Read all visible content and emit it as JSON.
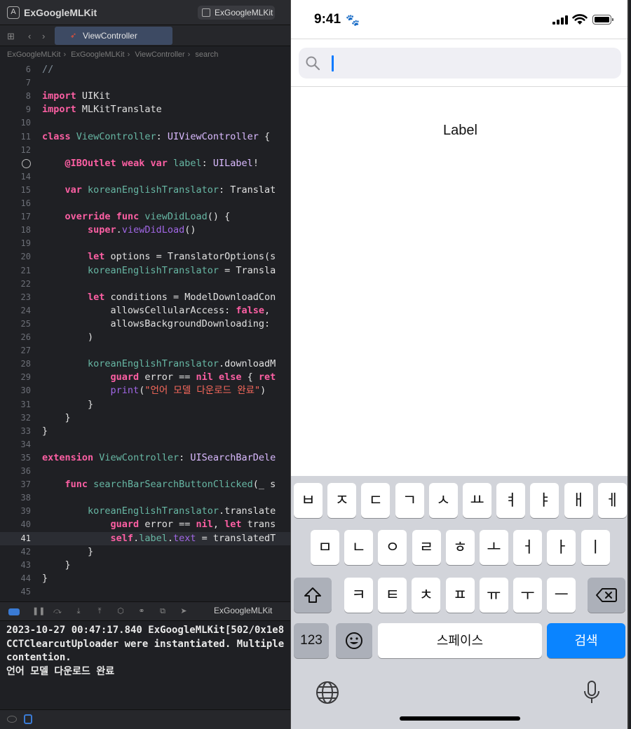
{
  "xcode": {
    "project_title": "ExGoogleMLKit",
    "scheme": "ExGoogleMLKit",
    "active_tab": "ViewController",
    "breadcrumb": [
      "ExGoogleMLKit",
      "ExGoogleMLKit",
      "ViewController",
      "search"
    ],
    "debug_scheme": "ExGoogleMLKit",
    "console_lines": [
      "2023-10-27 00:47:17.840 ExGoogleMLKit[502/0x1e8",
      "CCTClearcutUploader were instantiated. Multiple",
      "contention.",
      "언어 모델 다운로드 완료"
    ]
  },
  "code_lines": [
    {
      "n": "6",
      "tokens": [
        [
          "c",
          "//"
        ]
      ]
    },
    {
      "n": "7",
      "tokens": []
    },
    {
      "n": "8",
      "tokens": [
        [
          "k",
          "import"
        ],
        [
          "",
          " UIKit"
        ]
      ]
    },
    {
      "n": "9",
      "tokens": [
        [
          "k",
          "import"
        ],
        [
          "",
          " MLKitTranslate"
        ]
      ]
    },
    {
      "n": "10",
      "tokens": []
    },
    {
      "n": "11",
      "tokens": [
        [
          "k",
          "class"
        ],
        [
          "",
          " "
        ],
        [
          "p",
          "ViewController"
        ],
        [
          "",
          ": "
        ],
        [
          "ty",
          "UIViewController"
        ],
        [
          "",
          " {"
        ]
      ]
    },
    {
      "n": "12",
      "tokens": []
    },
    {
      "n": "",
      "breakpoint": true,
      "tokens": [
        [
          "",
          "    "
        ],
        [
          "k",
          "@IBOutlet"
        ],
        [
          "",
          " "
        ],
        [
          "k",
          "weak"
        ],
        [
          "",
          " "
        ],
        [
          "k",
          "var"
        ],
        [
          "",
          " "
        ],
        [
          "p",
          "label"
        ],
        [
          "",
          ": "
        ],
        [
          "ty",
          "UILabel"
        ],
        [
          "",
          "!"
        ]
      ]
    },
    {
      "n": "14",
      "tokens": []
    },
    {
      "n": "15",
      "tokens": [
        [
          "",
          "    "
        ],
        [
          "k",
          "var"
        ],
        [
          "",
          " "
        ],
        [
          "p",
          "koreanEnglishTranslator"
        ],
        [
          "",
          ": Translat"
        ]
      ]
    },
    {
      "n": "16",
      "tokens": []
    },
    {
      "n": "17",
      "tokens": [
        [
          "",
          "    "
        ],
        [
          "k",
          "override"
        ],
        [
          "",
          " "
        ],
        [
          "k",
          "func"
        ],
        [
          "",
          " "
        ],
        [
          "p",
          "viewDidLoad"
        ],
        [
          "",
          "() {"
        ]
      ]
    },
    {
      "n": "18",
      "tokens": [
        [
          "",
          "        "
        ],
        [
          "k",
          "super"
        ],
        [
          "",
          "."
        ],
        [
          "m",
          "viewDidLoad"
        ],
        [
          "",
          "()"
        ]
      ]
    },
    {
      "n": "19",
      "tokens": []
    },
    {
      "n": "20",
      "tokens": [
        [
          "",
          "        "
        ],
        [
          "k",
          "let"
        ],
        [
          "",
          " options = TranslatorOptions(s"
        ]
      ]
    },
    {
      "n": "21",
      "tokens": [
        [
          "",
          "        "
        ],
        [
          "p",
          "koreanEnglishTranslator"
        ],
        [
          "",
          " = Transla"
        ]
      ]
    },
    {
      "n": "22",
      "tokens": []
    },
    {
      "n": "23",
      "tokens": [
        [
          "",
          "        "
        ],
        [
          "k",
          "let"
        ],
        [
          "",
          " conditions = ModelDownloadCon"
        ]
      ]
    },
    {
      "n": "24",
      "tokens": [
        [
          "",
          "            allowsCellularAccess: "
        ],
        [
          "k",
          "false"
        ],
        [
          "",
          ","
        ]
      ]
    },
    {
      "n": "25",
      "tokens": [
        [
          "",
          "            allowsBackgroundDownloading:"
        ]
      ]
    },
    {
      "n": "26",
      "tokens": [
        [
          "",
          "        )"
        ]
      ]
    },
    {
      "n": "27",
      "tokens": []
    },
    {
      "n": "28",
      "tokens": [
        [
          "",
          "        "
        ],
        [
          "p",
          "koreanEnglishTranslator"
        ],
        [
          "",
          ".downloadM"
        ]
      ]
    },
    {
      "n": "29",
      "tokens": [
        [
          "",
          "            "
        ],
        [
          "k",
          "guard"
        ],
        [
          "",
          " error == "
        ],
        [
          "k",
          "nil"
        ],
        [
          "",
          " "
        ],
        [
          "k",
          "else"
        ],
        [
          "",
          " { "
        ],
        [
          "k",
          "ret"
        ]
      ]
    },
    {
      "n": "30",
      "tokens": [
        [
          "",
          "            "
        ],
        [
          "m",
          "print"
        ],
        [
          "",
          "("
        ],
        [
          "s",
          "\"언어 모델 다운로드 완료\""
        ],
        [
          "",
          ")"
        ]
      ]
    },
    {
      "n": "31",
      "tokens": [
        [
          "",
          "        }"
        ]
      ]
    },
    {
      "n": "32",
      "tokens": [
        [
          "",
          "    }"
        ]
      ]
    },
    {
      "n": "33",
      "tokens": [
        [
          "",
          "}"
        ]
      ]
    },
    {
      "n": "34",
      "tokens": []
    },
    {
      "n": "35",
      "tokens": [
        [
          "k",
          "extension"
        ],
        [
          "",
          " "
        ],
        [
          "p",
          "ViewController"
        ],
        [
          "",
          ": "
        ],
        [
          "ty",
          "UISearchBarDele"
        ]
      ]
    },
    {
      "n": "36",
      "tokens": []
    },
    {
      "n": "37",
      "tokens": [
        [
          "",
          "    "
        ],
        [
          "k",
          "func"
        ],
        [
          "",
          " "
        ],
        [
          "p",
          "searchBarSearchButtonClicked"
        ],
        [
          "",
          "(_ s"
        ]
      ]
    },
    {
      "n": "38",
      "tokens": []
    },
    {
      "n": "39",
      "tokens": [
        [
          "",
          "        "
        ],
        [
          "p",
          "koreanEnglishTranslator"
        ],
        [
          "",
          ".translate"
        ]
      ]
    },
    {
      "n": "40",
      "tokens": [
        [
          "",
          "            "
        ],
        [
          "k",
          "guard"
        ],
        [
          "",
          " error == "
        ],
        [
          "k",
          "nil"
        ],
        [
          "",
          ", "
        ],
        [
          "k",
          "let"
        ],
        [
          "",
          " trans"
        ]
      ]
    },
    {
      "n": "41",
      "current": true,
      "tokens": [
        [
          "",
          "            "
        ],
        [
          "k",
          "self"
        ],
        [
          "",
          "."
        ],
        [
          "p",
          "label"
        ],
        [
          "",
          "."
        ],
        [
          "m",
          "text"
        ],
        [
          "",
          " = translatedT"
        ]
      ]
    },
    {
      "n": "42",
      "tokens": [
        [
          "",
          "        }"
        ]
      ]
    },
    {
      "n": "43",
      "tokens": [
        [
          "",
          "    }"
        ]
      ]
    },
    {
      "n": "44",
      "tokens": [
        [
          "",
          "}"
        ]
      ]
    },
    {
      "n": "45",
      "tokens": []
    }
  ],
  "phone": {
    "time": "9:41",
    "search_placeholder": "",
    "label_text": "Label"
  },
  "keyboard": {
    "row1": [
      "ㅂ",
      "ㅈ",
      "ㄷ",
      "ㄱ",
      "ㅅ",
      "ㅛ",
      "ㅕ",
      "ㅑ",
      "ㅐ",
      "ㅔ"
    ],
    "row2": [
      "ㅁ",
      "ㄴ",
      "ㅇ",
      "ㄹ",
      "ㅎ",
      "ㅗ",
      "ㅓ",
      "ㅏ",
      "ㅣ"
    ],
    "row3": [
      "ㅋ",
      "ㅌ",
      "ㅊ",
      "ㅍ",
      "ㅠ",
      "ㅜ",
      "ㅡ"
    ],
    "num_key": "123",
    "space_key": "스페이스",
    "search_key": "검색"
  },
  "colors": {
    "keyword": "#fc5fa3",
    "project_symbol": "#67b7a4",
    "type_name": "#dabaff",
    "method": "#a167e6",
    "string": "#fc6a5d",
    "ios_blue": "#0a84ff"
  }
}
